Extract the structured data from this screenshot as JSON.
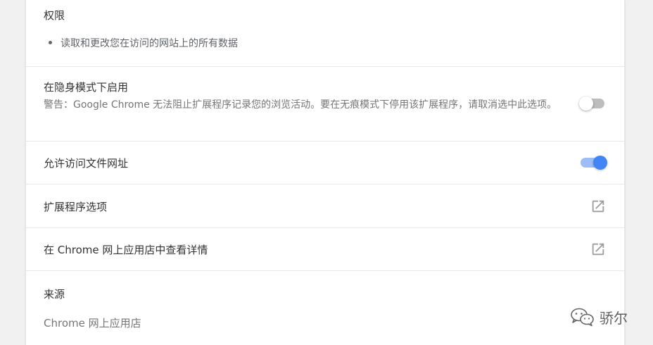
{
  "permissions": {
    "title": "权限",
    "items": [
      "读取和更改您在访问的网站上的所有数据"
    ]
  },
  "incognito": {
    "title": "在隐身模式下启用",
    "warning": "警告：Google Chrome 无法阻止扩展程序记录您的浏览活动。要在无痕模式下停用该扩展程序，请取消选中此选项。",
    "enabled": false
  },
  "file_urls": {
    "title": "允许访问文件网址",
    "enabled": true
  },
  "options": {
    "title": "扩展程序选项",
    "icon": "open-in-new-icon"
  },
  "store": {
    "title": "在 Chrome 网上应用店中查看详情",
    "icon": "open-in-new-icon"
  },
  "source": {
    "title": "来源",
    "value": "Chrome 网上应用店"
  },
  "watermark": {
    "text": "骄尔",
    "icon": "wechat-icon"
  },
  "colors": {
    "accent": "#4285f4",
    "accent_track": "#9cbdf8",
    "text": "#333333",
    "muted": "#757575",
    "background": "#f1f1f1"
  }
}
